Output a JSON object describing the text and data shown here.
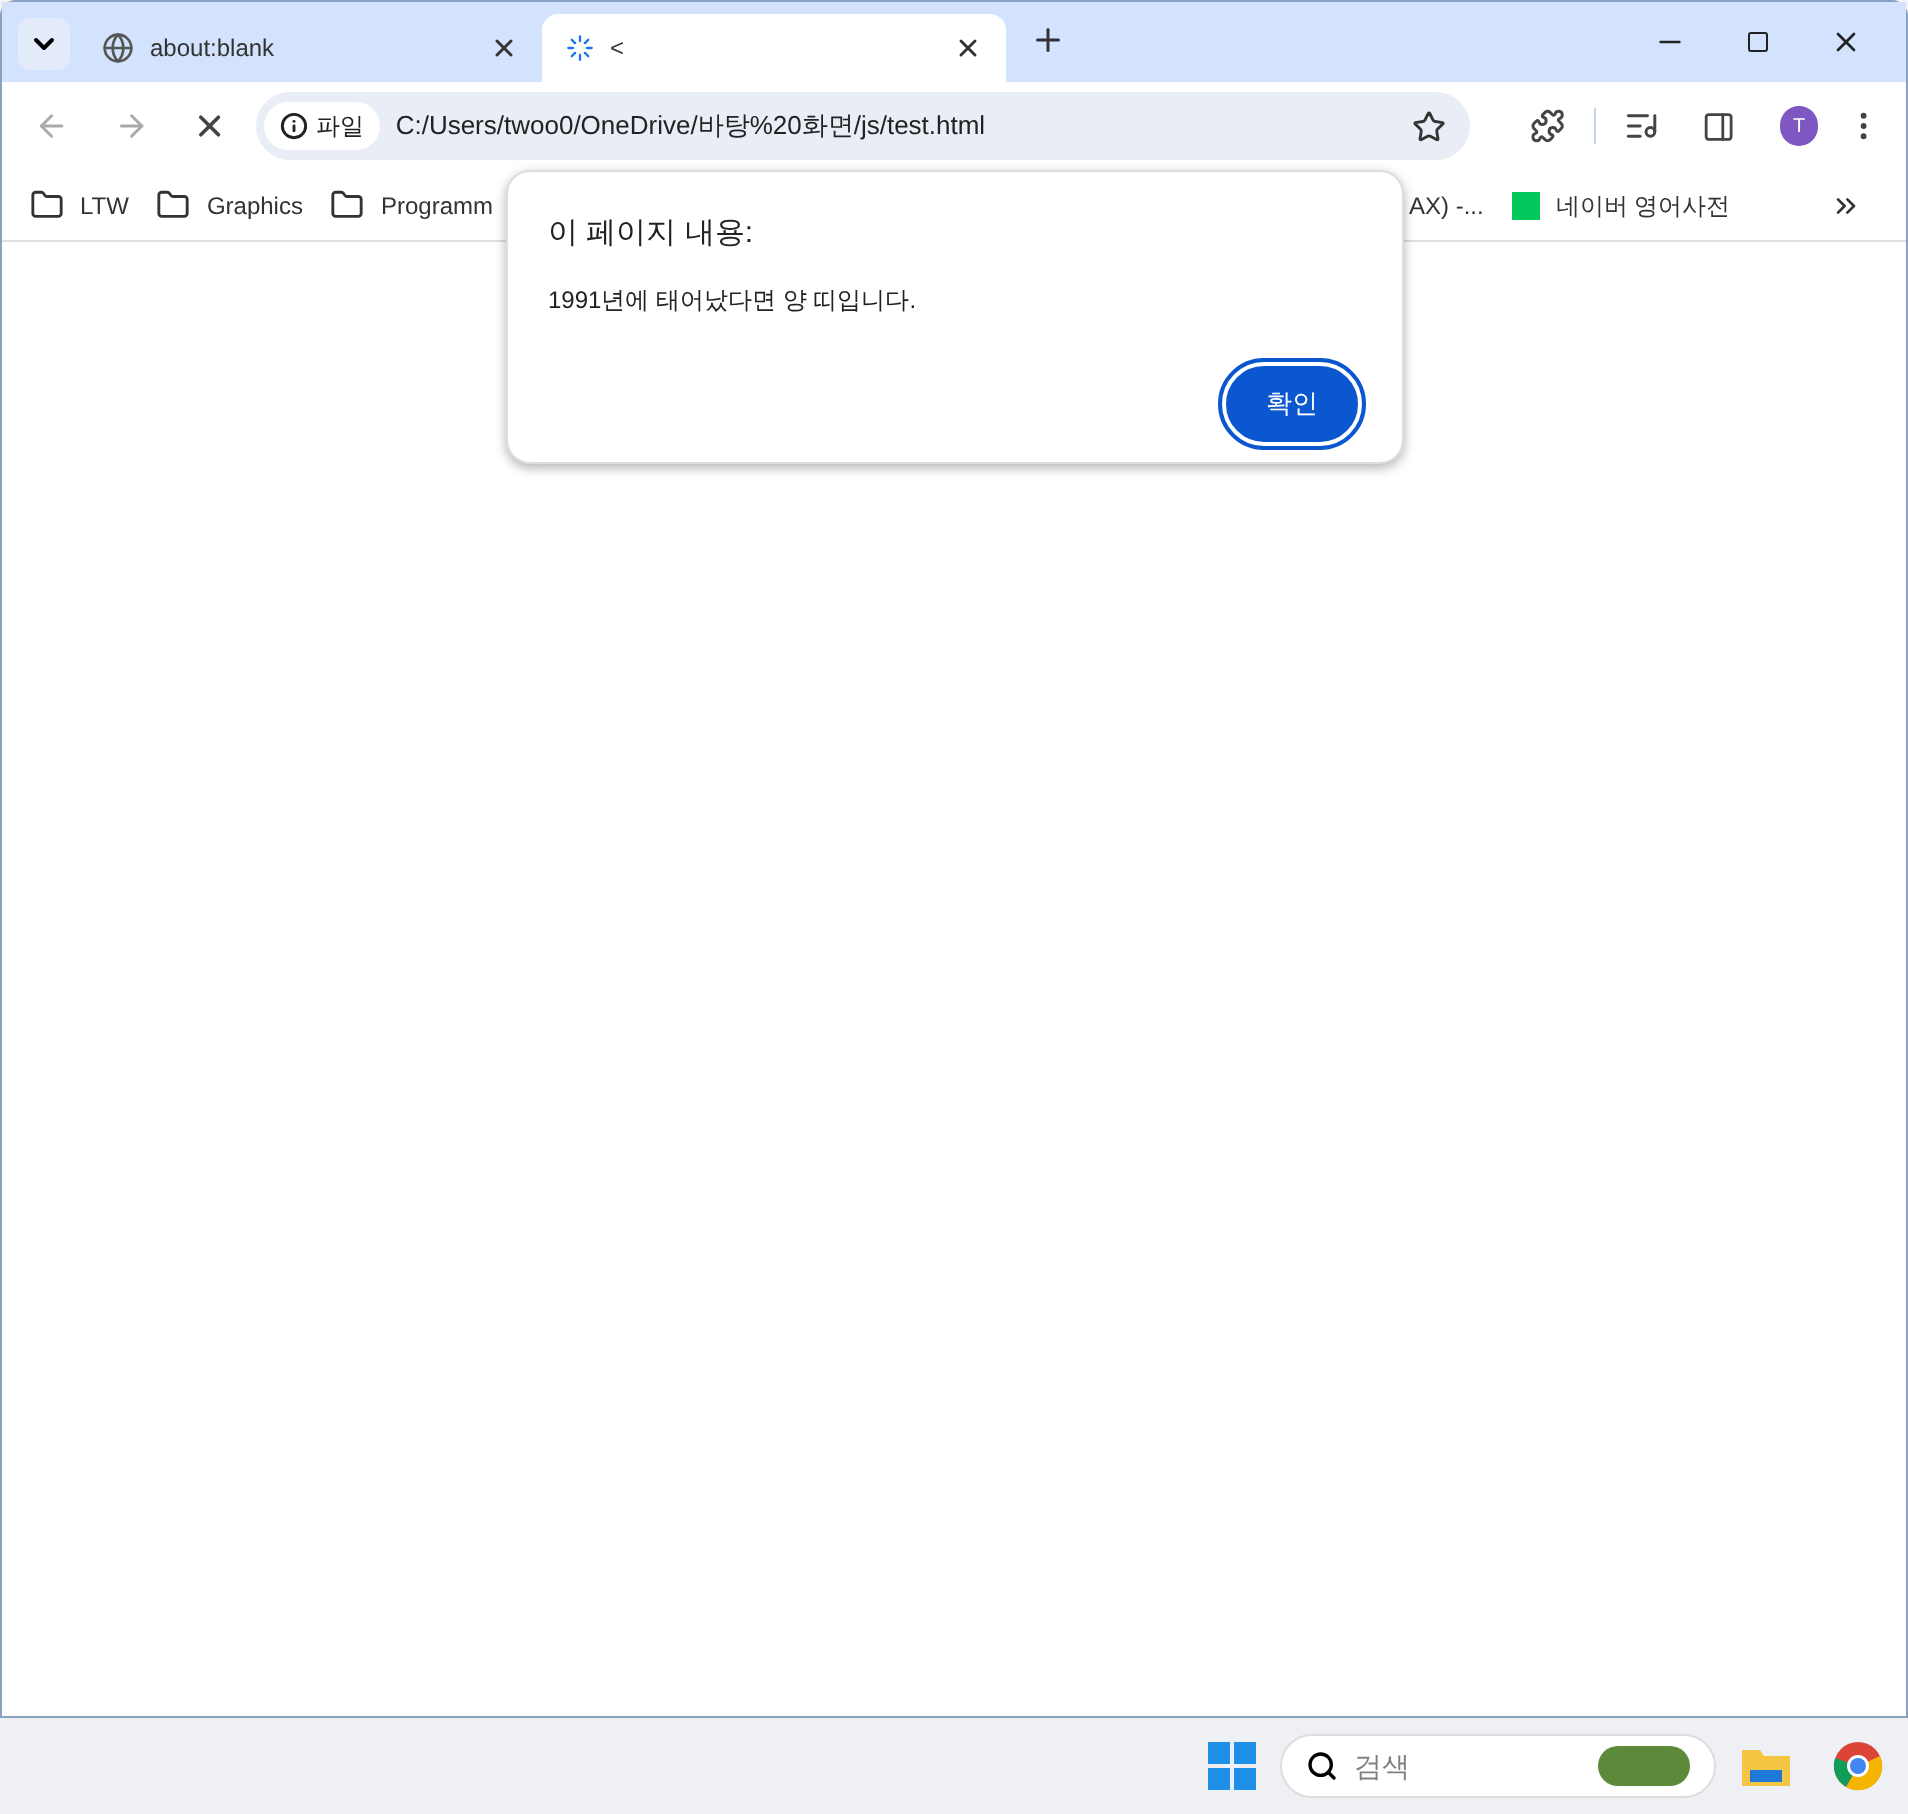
{
  "tabs": [
    {
      "title": "about:blank",
      "selected": false,
      "loading": false
    },
    {
      "title": "<",
      "selected": true,
      "loading": true
    }
  ],
  "address_bar": {
    "chip": "파일",
    "url": "C:/Users/twoo0/OneDrive/바탕%20화면/js/test.html"
  },
  "profile": {
    "initial": "T"
  },
  "bookmarks": [
    {
      "label": "LTW",
      "kind": "folder"
    },
    {
      "label": "Graphics",
      "kind": "folder"
    },
    {
      "label": "Programm",
      "kind": "folder"
    },
    {
      "label": "AX) -...",
      "kind": "page"
    },
    {
      "label": "네이버 영어사전",
      "kind": "site"
    }
  ],
  "dialog": {
    "title": "이 페이지 내용:",
    "message": "1991년에 태어났다면 양 띠입니다.",
    "button": "확인"
  },
  "taskbar": {
    "search_placeholder": "검색"
  }
}
